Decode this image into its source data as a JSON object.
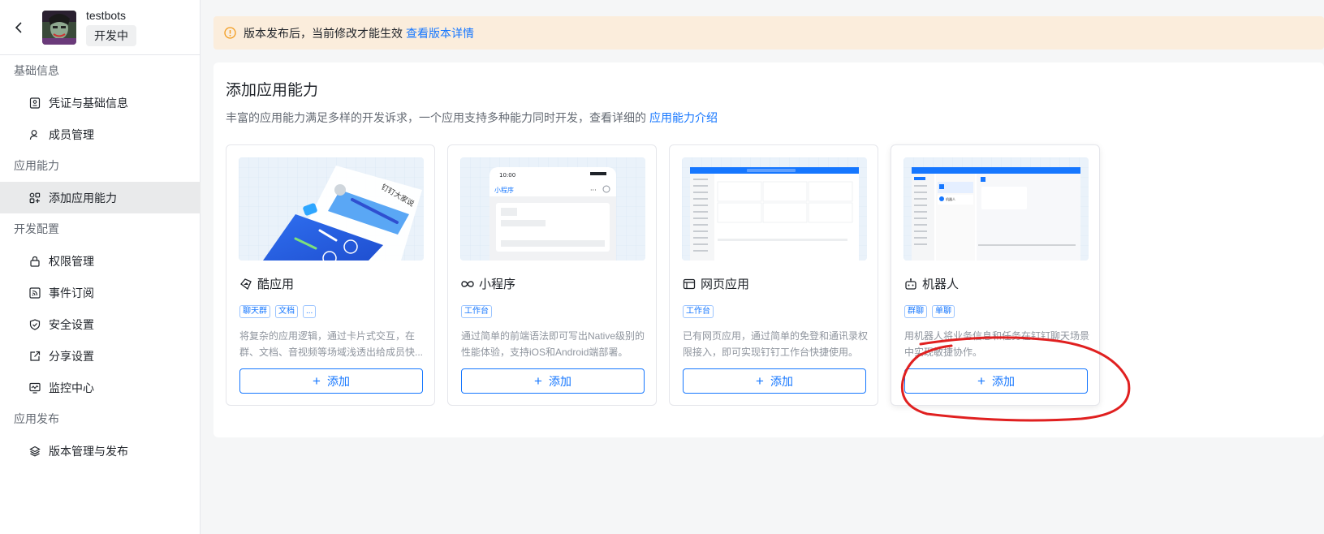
{
  "app": {
    "name": "testbots",
    "status": "开发中"
  },
  "sidebar": {
    "groups": [
      {
        "title": "基础信息",
        "items": [
          {
            "label": "凭证与基础信息",
            "icon": "credential-icon"
          },
          {
            "label": "成员管理",
            "icon": "user-icon"
          }
        ]
      },
      {
        "title": "应用能力",
        "items": [
          {
            "label": "添加应用能力",
            "icon": "apps-add-icon",
            "active": true
          }
        ]
      },
      {
        "title": "开发配置",
        "items": [
          {
            "label": "权限管理",
            "icon": "lock-icon"
          },
          {
            "label": "事件订阅",
            "icon": "rss-icon"
          },
          {
            "label": "安全设置",
            "icon": "shield-icon"
          },
          {
            "label": "分享设置",
            "icon": "share-icon"
          },
          {
            "label": "监控中心",
            "icon": "monitor-icon"
          }
        ]
      },
      {
        "title": "应用发布",
        "items": [
          {
            "label": "版本管理与发布",
            "icon": "layers-icon"
          }
        ]
      }
    ]
  },
  "banner": {
    "text": "版本发布后，当前修改才能生效",
    "link": "查看版本详情"
  },
  "main": {
    "title": "添加应用能力",
    "desc": "丰富的应用能力满足多样的开发诉求，一个应用支持多种能力同时开发，查看详细的",
    "desc_link": "应用能力介绍",
    "cards": [
      {
        "title": "酷应用",
        "icon": "cool-app-icon",
        "tags": [
          "聊天群",
          "文档",
          "..."
        ],
        "desc": "将复杂的应用逻辑，通过卡片式交互，在群、文档、音视频等场域浅透出给成员快...",
        "button": "添加",
        "thumb_text": "钉钉大家说"
      },
      {
        "title": "小程序",
        "icon": "mini-program-icon",
        "tags": [
          "工作台"
        ],
        "desc": "通过简单的前端语法即可写出Native级别的性能体验，支持iOS和Android端部署。",
        "button": "添加",
        "thumb_time": "10:00",
        "thumb_title": "小程序"
      },
      {
        "title": "网页应用",
        "icon": "web-app-icon",
        "tags": [
          "工作台"
        ],
        "desc": "已有网页应用，通过简单的免登和通讯录权限接入，即可实现钉钉工作台快捷使用。",
        "button": "添加"
      },
      {
        "title": "机器人",
        "icon": "robot-icon",
        "tags": [
          "群聊",
          "单聊"
        ],
        "desc": "用机器人将业务信息和任务在钉钉聊天场景中实现敏捷协作。",
        "button": "添加",
        "thumb_text": "机器人"
      }
    ]
  },
  "colors": {
    "accent": "#1677ff",
    "banner_bg": "#fbeddc",
    "annotation": "#e02020"
  }
}
